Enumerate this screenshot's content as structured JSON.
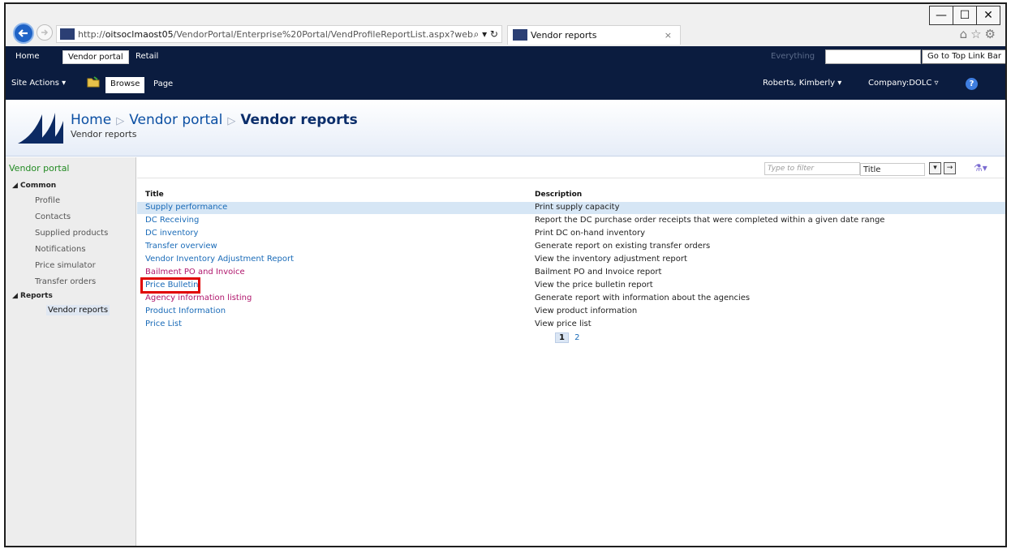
{
  "browser": {
    "url_prefix": "http://",
    "url_host": "oitsoclmaost05",
    "url_path": "/VendorPortal/Enterprise%20Portal/VendProfileReportList.aspx?web",
    "addr_icons": "⌕ ▾ ↻",
    "tab_title": "Vendor reports",
    "tab_close": "×",
    "minimize": "—",
    "maximize": "☐",
    "close": "✕",
    "toolbar_icons": "⌂☆⚙"
  },
  "top_links": {
    "home": "Home",
    "vendor_portal": "Vendor portal",
    "retail": "Retail",
    "search_scope": "Everything",
    "goto_label": "Go to Top Link Bar"
  },
  "ribbon": {
    "site_actions": "Site Actions ▾",
    "browse": "Browse",
    "page": "Page",
    "user": "Roberts, Kimberly ▾",
    "company": "Company:DOLC ▿",
    "help": "?"
  },
  "title_area": {
    "bc_home": "Home",
    "bc_portal": "Vendor portal",
    "bc_current": "Vendor reports",
    "separator": "▷",
    "subtitle": "Vendor reports"
  },
  "nav": {
    "root": "Vendor portal",
    "common": "◢ Common",
    "profile": "Profile",
    "contacts": "Contacts",
    "supplied_products": "Supplied products",
    "notifications": "Notifications",
    "price_simulator": "Price simulator",
    "transfer_orders": "Transfer orders",
    "reports": "◢ Reports",
    "vendor_reports": "Vendor reports"
  },
  "filter": {
    "placeholder": "Type to filter",
    "field": "Title",
    "dropdown": "▾",
    "go": "→",
    "options": "⚗▾"
  },
  "table": {
    "col_title": "Title",
    "col_desc": "Description",
    "rows": [
      {
        "title": "Supply performance",
        "desc": "Print supply capacity"
      },
      {
        "title": "DC Receiving",
        "desc": "Report the DC purchase order receipts that were completed within a given date range"
      },
      {
        "title": "DC inventory",
        "desc": "Print DC on-hand inventory"
      },
      {
        "title": "Transfer overview",
        "desc": "Generate report on existing transfer orders"
      },
      {
        "title": "Vendor Inventory Adjustment Report",
        "desc": "View the inventory adjustment report"
      },
      {
        "title": "Bailment PO and Invoice",
        "desc": "Bailment PO and Invoice report"
      },
      {
        "title": "Price Bulletin",
        "desc": "View the price bulletin report"
      },
      {
        "title": "Agency information listing",
        "desc": "Generate report with information about the agencies"
      },
      {
        "title": "Product Information",
        "desc": "View product information"
      },
      {
        "title": "Price List",
        "desc": "View price list"
      }
    ]
  },
  "pager": {
    "current": "1",
    "next": "2"
  },
  "colors": {
    "topbar": "#0b1c3f",
    "link": "#1a6bb8",
    "visited": "#b0166c",
    "nav_root": "#228a22",
    "highlight_row": "#d6e6f5",
    "callout": "#e00000"
  }
}
